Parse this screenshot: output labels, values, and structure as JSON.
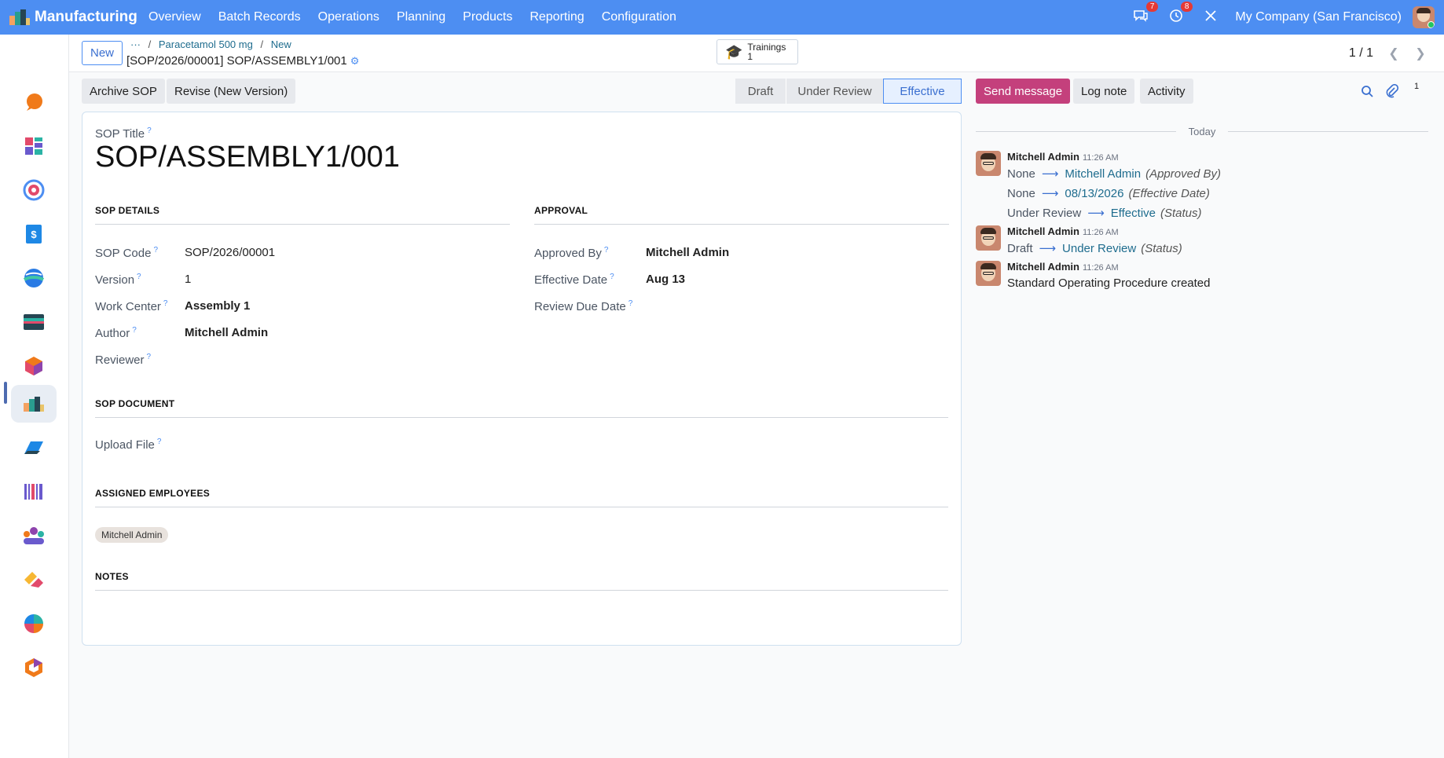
{
  "app": {
    "name": "Manufacturing",
    "menu": [
      "Overview",
      "Batch Records",
      "Operations",
      "Planning",
      "Products",
      "Reporting",
      "Configuration"
    ],
    "chat_count": "7",
    "activity_count": "8",
    "company": "My Company (San Francisco)"
  },
  "control": {
    "new_label": "New",
    "breadcrumb_more": "···",
    "breadcrumb": [
      "Paracetamol 500 mg",
      "New"
    ],
    "record_title": "[SOP/2026/00001] SOP/ASSEMBLY1/001",
    "trainings_label": "Trainings",
    "trainings_count": "1",
    "pager": "1 / 1"
  },
  "actions": {
    "archive": "Archive SOP",
    "revise": "Revise (New Version)",
    "statuses": [
      "Draft",
      "Under Review",
      "Effective"
    ],
    "current_status": "Effective"
  },
  "form": {
    "title_label": "SOP Title",
    "title": "SOP/ASSEMBLY1/001",
    "sop_details_heading": "SOP DETAILS",
    "approval_heading": "APPROVAL",
    "fields_left": [
      {
        "label": "SOP Code",
        "value": "SOP/2026/00001"
      },
      {
        "label": "Version",
        "value": "1"
      },
      {
        "label": "Work Center",
        "value": "Assembly 1"
      },
      {
        "label": "Author",
        "value": "Mitchell Admin"
      },
      {
        "label": "Reviewer",
        "value": ""
      }
    ],
    "fields_right": [
      {
        "label": "Approved By",
        "value": "Mitchell Admin"
      },
      {
        "label": "Effective Date",
        "value": "Aug 13"
      },
      {
        "label": "Review Due Date",
        "value": ""
      }
    ],
    "document_heading": "SOP DOCUMENT",
    "upload_label": "Upload File",
    "employees_heading": "ASSIGNED EMPLOYEES",
    "employees": [
      "Mitchell Admin"
    ],
    "notes_heading": "NOTES"
  },
  "chatter": {
    "send_message": "Send message",
    "log_note": "Log note",
    "activity": "Activity",
    "followers_count": "1",
    "date_separator": "Today",
    "messages": [
      {
        "author": "Mitchell Admin",
        "time": "11:26 AM",
        "changes": [
          {
            "from": "None",
            "to": "Mitchell Admin",
            "field": "(Approved By)"
          },
          {
            "from": "None",
            "to": "08/13/2026",
            "field": "(Effective Date)"
          },
          {
            "from": "Under Review",
            "to": "Effective",
            "field": "(Status)"
          }
        ]
      },
      {
        "author": "Mitchell Admin",
        "time": "11:26 AM",
        "changes": [
          {
            "from": "Draft",
            "to": "Under Review",
            "field": "(Status)"
          }
        ]
      },
      {
        "author": "Mitchell Admin",
        "time": "11:26 AM",
        "body": "Standard Operating Procedure created"
      }
    ]
  },
  "colors": {
    "navbar": "#4d8ef2",
    "primary_button": "#c4407c",
    "link": "#1e6c8e"
  }
}
